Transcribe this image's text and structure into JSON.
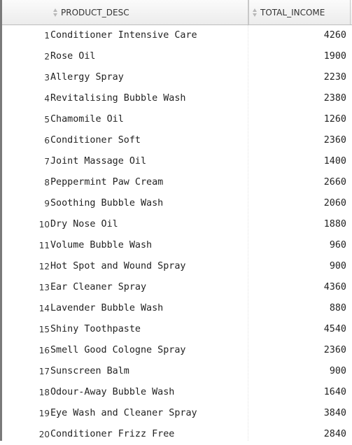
{
  "table": {
    "columns": {
      "product_desc": "PRODUCT_DESC",
      "total_income": "TOTAL_INCOME"
    },
    "rows": [
      {
        "num": "1",
        "desc": "Conditioner Intensive Care",
        "income": "4260"
      },
      {
        "num": "2",
        "desc": "Rose Oil",
        "income": "1900"
      },
      {
        "num": "3",
        "desc": "Allergy Spray",
        "income": "2230"
      },
      {
        "num": "4",
        "desc": "Revitalising Bubble Wash",
        "income": "2380"
      },
      {
        "num": "5",
        "desc": "Chamomile Oil",
        "income": "1260"
      },
      {
        "num": "6",
        "desc": "Conditioner Soft",
        "income": "2360"
      },
      {
        "num": "7",
        "desc": "Joint Massage Oil",
        "income": "1400"
      },
      {
        "num": "8",
        "desc": "Peppermint Paw Cream",
        "income": "2660"
      },
      {
        "num": "9",
        "desc": "Soothing Bubble Wash",
        "income": "2060"
      },
      {
        "num": "10",
        "desc": "Dry Nose Oil",
        "income": "1880"
      },
      {
        "num": "11",
        "desc": "Volume Bubble Wash",
        "income": "960"
      },
      {
        "num": "12",
        "desc": "Hot Spot and Wound Spray",
        "income": "900"
      },
      {
        "num": "13",
        "desc": "Ear Cleaner Spray",
        "income": "4360"
      },
      {
        "num": "14",
        "desc": "Lavender Bubble Wash",
        "income": "880"
      },
      {
        "num": "15",
        "desc": "Shiny Toothpaste",
        "income": "4540"
      },
      {
        "num": "16",
        "desc": "Smell Good Cologne Spray",
        "income": "2360"
      },
      {
        "num": "17",
        "desc": "Sunscreen Balm",
        "income": "900"
      },
      {
        "num": "18",
        "desc": "Odour-Away Bubble Wash",
        "income": "1640"
      },
      {
        "num": "19",
        "desc": "Eye Wash and Cleaner Spray",
        "income": "3840"
      },
      {
        "num": "20",
        "desc": "Conditioner Frizz Free",
        "income": "2840"
      }
    ]
  }
}
